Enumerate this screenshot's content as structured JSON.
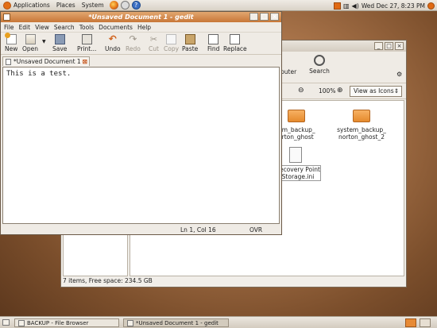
{
  "top_panel": {
    "menus": [
      "Applications",
      "Places",
      "System"
    ],
    "datetime": "Wed Dec 27,  8:23 PM"
  },
  "file_browser": {
    "toolbar": {
      "computer_label": "puter",
      "search_label": "Search"
    },
    "zoom": "100%",
    "view_mode": "View as Icons",
    "items": [
      "stem_backup_\nnorton_ghost",
      "system_backup_\nnorton_ghost_2",
      "Recovery Point\nStorage.ini"
    ],
    "status": "7 items, Free space: 234.5 GB"
  },
  "gedit": {
    "title": "*Unsaved Document 1 - gedit",
    "menus": [
      "File",
      "Edit",
      "View",
      "Search",
      "Tools",
      "Documents",
      "Help"
    ],
    "toolbar": {
      "new": "New",
      "open": "Open",
      "save": "Save",
      "print": "Print...",
      "undo": "Undo",
      "redo": "Redo",
      "cut": "Cut",
      "copy": "Copy",
      "paste": "Paste",
      "find": "Find",
      "replace": "Replace"
    },
    "tab_label": "*Unsaved Document 1",
    "content": "This is a test.",
    "cursor": "Ln 1, Col 16",
    "mode": "OVR"
  },
  "taskbar": {
    "items": [
      "BACKUP - File Browser",
      "*Unsaved Document 1 - gedit"
    ]
  }
}
